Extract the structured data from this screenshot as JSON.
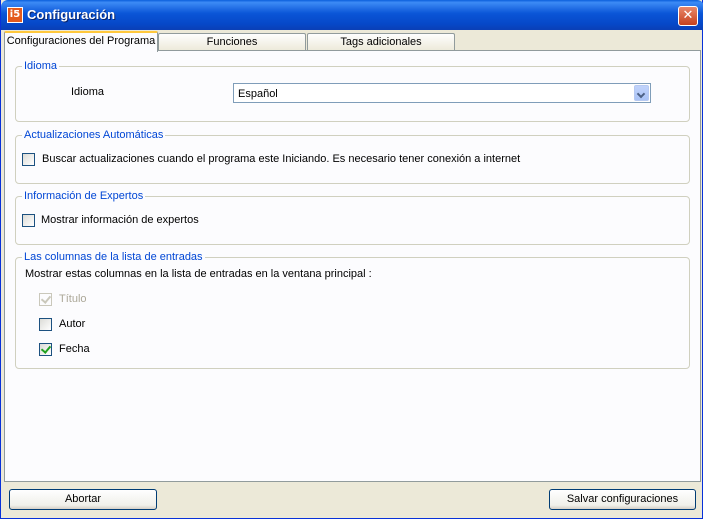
{
  "window": {
    "title": "Configuración",
    "app_icon_glyph": "i5",
    "close_glyph": "✕"
  },
  "tabs": [
    {
      "label": "Configuraciones del Programa",
      "active": true
    },
    {
      "label": "Funciones",
      "active": false
    },
    {
      "label": "Tags adicionales",
      "active": false
    }
  ],
  "idioma": {
    "legend": "Idioma",
    "label": "Idioma",
    "selected": "Español"
  },
  "actualizaciones": {
    "legend": "Actualizaciones Automáticas",
    "checkbox_label": "Buscar actualizaciones cuando el programa este Iniciando. Es necesario tener conexión a internet",
    "checked": false
  },
  "expertos": {
    "legend": "Información de Expertos",
    "checkbox_label": "Mostrar información de expertos",
    "checked": false
  },
  "columnas": {
    "legend": "Las columnas de la lista de entradas",
    "description": "Mostrar estas columnas en la lista de entradas en la ventana principal :",
    "items": [
      {
        "label": "Título",
        "checked": true,
        "disabled": true
      },
      {
        "label": "Autor",
        "checked": false,
        "disabled": false
      },
      {
        "label": "Fecha",
        "checked": true,
        "disabled": false
      }
    ]
  },
  "buttons": {
    "cancel": "Abortar",
    "save": "Salvar configuraciones"
  },
  "colors": {
    "title_bar": "#0a55d7",
    "legend_text": "#0046d5",
    "close_button": "#c6411d",
    "tab_highlight": "#ffc83c"
  },
  "icons": {
    "app": "app-logo-icon",
    "close": "close-icon",
    "dropdown": "chevron-down-icon",
    "check": "checkmark-icon"
  }
}
